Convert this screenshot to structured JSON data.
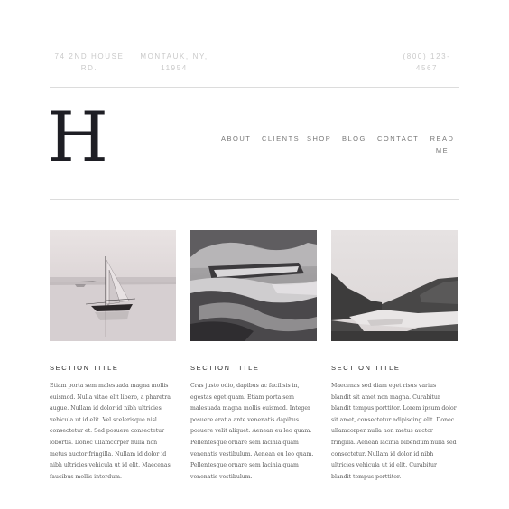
{
  "header": {
    "address": "74 2ND HOUSE RD.",
    "city": "MONTAUK, NY, 11954",
    "phone": "(800) 123-4567",
    "logo_letter": "H"
  },
  "nav": {
    "items": [
      {
        "label": "ABOUT"
      },
      {
        "label": "CLIENTS"
      },
      {
        "label": "SHOP"
      },
      {
        "label": "BLOG"
      },
      {
        "label": "CONTACT"
      },
      {
        "label": "READ ME"
      }
    ]
  },
  "sections": [
    {
      "title": "SECTION TITLE",
      "image": "sailboat-photo",
      "text": "Etiam porta sem malesuada magna mollis euismod. Nulla vitae elit libero, a pharetra augue. Nullam id dolor id nibh ultricies vehicula ut id elit. Vel scelerisque nisl consectetur et. Sed posuere consectetur  lobortis. Donec ullamcorper nulla non metus auctor fringilla. Nullam id dolor id nibh ultricies vehicula ut id elit. Maecenas faucibus mollis interdum."
    },
    {
      "title": "SECTION TITLE",
      "image": "geyser-terrace-photo",
      "text": "Cras justo odio, dapibus ac facilisis in, egestas eget quam. Etiam porta sem malesuada magna mollis euismod. Integer posuere erat a ante venenatis dapibus posuere velit aliquet. Aenean eu leo quam. Pellentesque ornare sem lacinia quam venenatis vestibulum. Aenean eu leo quam. Pellentesque ornare sem lacinia quam venenatis vestibulum."
    },
    {
      "title": "SECTION TITLE",
      "image": "mountain-lake-photo",
      "text": "Maecenas sed diam eget risus varius blandit sit amet non magna. Curabitur blandit tempus porttitor. Lorem ipsum dolor sit amet, consectetur adipiscing elit. Donec ullamcorper nulla non metus auctor fringilla. Aenean lacinia bibendum nulla sed consectetur. Nullam id dolor id nibh ultricies vehicula ut id elit. Curabitur blandit tempus porttitor."
    }
  ]
}
